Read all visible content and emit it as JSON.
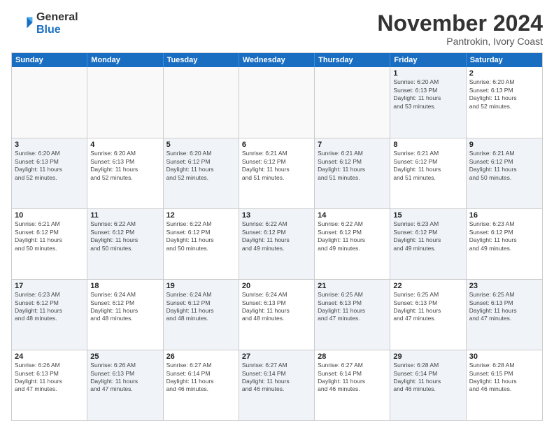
{
  "header": {
    "logo_general": "General",
    "logo_blue": "Blue",
    "month_title": "November 2024",
    "location": "Pantrokin, Ivory Coast"
  },
  "weekdays": [
    "Sunday",
    "Monday",
    "Tuesday",
    "Wednesday",
    "Thursday",
    "Friday",
    "Saturday"
  ],
  "rows": [
    [
      {
        "day": "",
        "info": "",
        "empty": true
      },
      {
        "day": "",
        "info": "",
        "empty": true
      },
      {
        "day": "",
        "info": "",
        "empty": true
      },
      {
        "day": "",
        "info": "",
        "empty": true
      },
      {
        "day": "",
        "info": "",
        "empty": true
      },
      {
        "day": "1",
        "info": "Sunrise: 6:20 AM\nSunset: 6:13 PM\nDaylight: 11 hours\nand 53 minutes.",
        "shaded": true
      },
      {
        "day": "2",
        "info": "Sunrise: 6:20 AM\nSunset: 6:13 PM\nDaylight: 11 hours\nand 52 minutes.",
        "shaded": false
      }
    ],
    [
      {
        "day": "3",
        "info": "Sunrise: 6:20 AM\nSunset: 6:13 PM\nDaylight: 11 hours\nand 52 minutes.",
        "shaded": true
      },
      {
        "day": "4",
        "info": "Sunrise: 6:20 AM\nSunset: 6:13 PM\nDaylight: 11 hours\nand 52 minutes.",
        "shaded": false
      },
      {
        "day": "5",
        "info": "Sunrise: 6:20 AM\nSunset: 6:12 PM\nDaylight: 11 hours\nand 52 minutes.",
        "shaded": true
      },
      {
        "day": "6",
        "info": "Sunrise: 6:21 AM\nSunset: 6:12 PM\nDaylight: 11 hours\nand 51 minutes.",
        "shaded": false
      },
      {
        "day": "7",
        "info": "Sunrise: 6:21 AM\nSunset: 6:12 PM\nDaylight: 11 hours\nand 51 minutes.",
        "shaded": true
      },
      {
        "day": "8",
        "info": "Sunrise: 6:21 AM\nSunset: 6:12 PM\nDaylight: 11 hours\nand 51 minutes.",
        "shaded": false
      },
      {
        "day": "9",
        "info": "Sunrise: 6:21 AM\nSunset: 6:12 PM\nDaylight: 11 hours\nand 50 minutes.",
        "shaded": true
      }
    ],
    [
      {
        "day": "10",
        "info": "Sunrise: 6:21 AM\nSunset: 6:12 PM\nDaylight: 11 hours\nand 50 minutes.",
        "shaded": false
      },
      {
        "day": "11",
        "info": "Sunrise: 6:22 AM\nSunset: 6:12 PM\nDaylight: 11 hours\nand 50 minutes.",
        "shaded": true
      },
      {
        "day": "12",
        "info": "Sunrise: 6:22 AM\nSunset: 6:12 PM\nDaylight: 11 hours\nand 50 minutes.",
        "shaded": false
      },
      {
        "day": "13",
        "info": "Sunrise: 6:22 AM\nSunset: 6:12 PM\nDaylight: 11 hours\nand 49 minutes.",
        "shaded": true
      },
      {
        "day": "14",
        "info": "Sunrise: 6:22 AM\nSunset: 6:12 PM\nDaylight: 11 hours\nand 49 minutes.",
        "shaded": false
      },
      {
        "day": "15",
        "info": "Sunrise: 6:23 AM\nSunset: 6:12 PM\nDaylight: 11 hours\nand 49 minutes.",
        "shaded": true
      },
      {
        "day": "16",
        "info": "Sunrise: 6:23 AM\nSunset: 6:12 PM\nDaylight: 11 hours\nand 49 minutes.",
        "shaded": false
      }
    ],
    [
      {
        "day": "17",
        "info": "Sunrise: 6:23 AM\nSunset: 6:12 PM\nDaylight: 11 hours\nand 48 minutes.",
        "shaded": true
      },
      {
        "day": "18",
        "info": "Sunrise: 6:24 AM\nSunset: 6:12 PM\nDaylight: 11 hours\nand 48 minutes.",
        "shaded": false
      },
      {
        "day": "19",
        "info": "Sunrise: 6:24 AM\nSunset: 6:12 PM\nDaylight: 11 hours\nand 48 minutes.",
        "shaded": true
      },
      {
        "day": "20",
        "info": "Sunrise: 6:24 AM\nSunset: 6:13 PM\nDaylight: 11 hours\nand 48 minutes.",
        "shaded": false
      },
      {
        "day": "21",
        "info": "Sunrise: 6:25 AM\nSunset: 6:13 PM\nDaylight: 11 hours\nand 47 minutes.",
        "shaded": true
      },
      {
        "day": "22",
        "info": "Sunrise: 6:25 AM\nSunset: 6:13 PM\nDaylight: 11 hours\nand 47 minutes.",
        "shaded": false
      },
      {
        "day": "23",
        "info": "Sunrise: 6:25 AM\nSunset: 6:13 PM\nDaylight: 11 hours\nand 47 minutes.",
        "shaded": true
      }
    ],
    [
      {
        "day": "24",
        "info": "Sunrise: 6:26 AM\nSunset: 6:13 PM\nDaylight: 11 hours\nand 47 minutes.",
        "shaded": false
      },
      {
        "day": "25",
        "info": "Sunrise: 6:26 AM\nSunset: 6:13 PM\nDaylight: 11 hours\nand 47 minutes.",
        "shaded": true
      },
      {
        "day": "26",
        "info": "Sunrise: 6:27 AM\nSunset: 6:14 PM\nDaylight: 11 hours\nand 46 minutes.",
        "shaded": false
      },
      {
        "day": "27",
        "info": "Sunrise: 6:27 AM\nSunset: 6:14 PM\nDaylight: 11 hours\nand 46 minutes.",
        "shaded": true
      },
      {
        "day": "28",
        "info": "Sunrise: 6:27 AM\nSunset: 6:14 PM\nDaylight: 11 hours\nand 46 minutes.",
        "shaded": false
      },
      {
        "day": "29",
        "info": "Sunrise: 6:28 AM\nSunset: 6:14 PM\nDaylight: 11 hours\nand 46 minutes.",
        "shaded": true
      },
      {
        "day": "30",
        "info": "Sunrise: 6:28 AM\nSunset: 6:15 PM\nDaylight: 11 hours\nand 46 minutes.",
        "shaded": false
      }
    ]
  ]
}
